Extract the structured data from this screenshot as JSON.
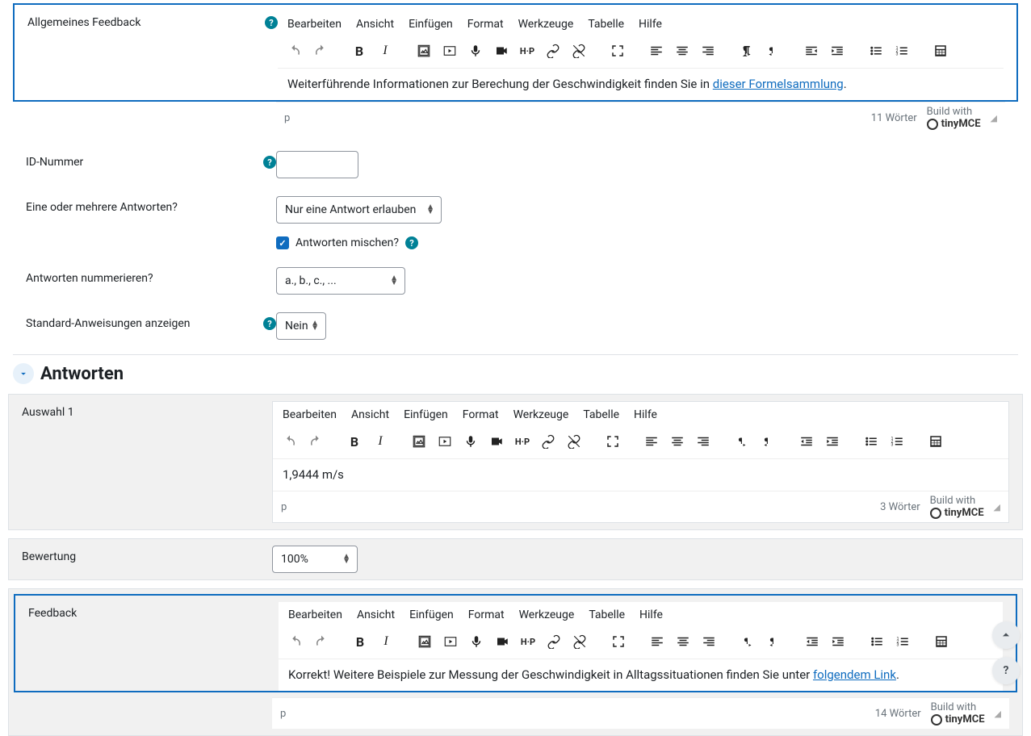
{
  "feedback_general": {
    "label": "Allgemeines Feedback",
    "menubar": {
      "edit": "Bearbeiten",
      "view": "Ansicht",
      "insert": "Einfügen",
      "format": "Format",
      "tools": "Werkzeuge",
      "table": "Tabelle",
      "help": "Hilfe"
    },
    "content_pre": "Weiterführende Informationen zur Berechung der Geschwindigkeit finden Sie in ",
    "content_link": "dieser Formelsammlung",
    "content_post": ".",
    "path": "p",
    "wordcount": "11 Wörter",
    "buildwith": "Build with"
  },
  "id_number": {
    "label": "ID-Nummer",
    "value": ""
  },
  "one_or_many": {
    "label": "Eine oder mehrere Antworten?",
    "selected": "Nur eine Antwort erlauben"
  },
  "shuffle": {
    "label": "Antworten mischen?",
    "checked": true
  },
  "numbering": {
    "label": "Antworten nummerieren?",
    "selected": "a., b., c., ..."
  },
  "show_instructions": {
    "label": "Standard-Anweisungen anzeigen",
    "selected": "Nein"
  },
  "answers_header": "Antworten",
  "choice1": {
    "label": "Auswahl 1",
    "content": "1,9444 m/s",
    "path": "p",
    "wordcount": "3 Wörter"
  },
  "grade": {
    "label": "Bewertung",
    "selected": "100%"
  },
  "choice1_feedback": {
    "label": "Feedback",
    "content_pre": "Korrekt! Weitere Beispiele zur Messung der Geschwindigkeit in Alltagssituationen finden Sie unter ",
    "content_link": "folgendem Link",
    "content_post": ".",
    "path": "p",
    "wordcount": "14 Wörter"
  },
  "tinymce": "tinyMCE",
  "icons": {
    "undo": "undo",
    "redo": "redo",
    "bold": "bold",
    "italic": "italic",
    "image": "image",
    "media": "media",
    "mic": "mic",
    "video": "video",
    "h5p": "h5p",
    "link": "link",
    "unlink": "unlink",
    "fullscreen": "fullscreen",
    "alignleft": "alignleft",
    "aligncenter": "aligncenter",
    "alignright": "alignright",
    "ltr": "ltr",
    "rtl": "rtl",
    "outdent": "outdent",
    "indent": "indent",
    "bullist": "bullist",
    "numlist": "numlist",
    "calc": "calc"
  }
}
